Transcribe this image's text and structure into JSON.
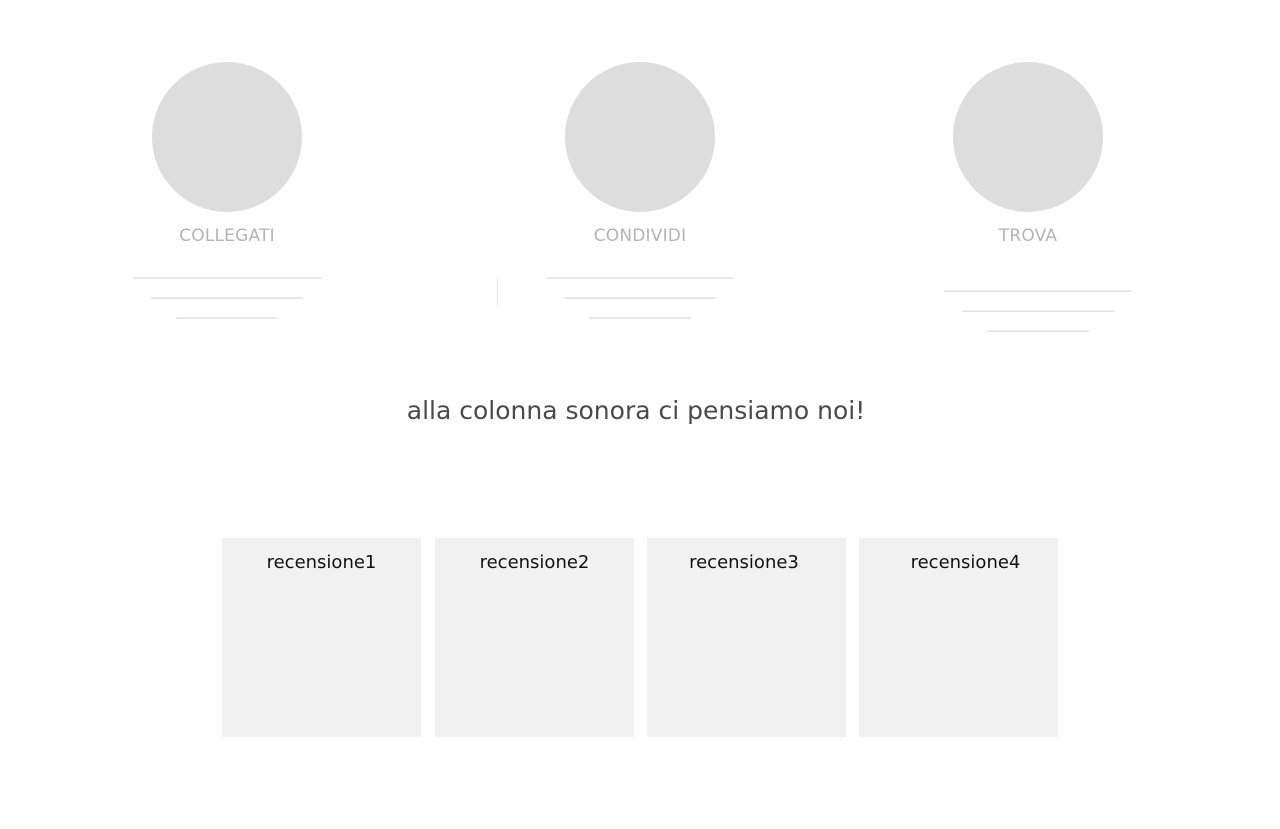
{
  "features": [
    {
      "label": "COLLEGATI",
      "lines": [
        "__________________________",
        "_____________________",
        "______________"
      ]
    },
    {
      "label": "CONDIVIDI",
      "lines": [
        "__________________________",
        "_____________________",
        "______________"
      ]
    },
    {
      "label": "TROVA",
      "lines": [
        "__________________________",
        "_____________________",
        "______________"
      ]
    }
  ],
  "tagline": "alla colonna sonora ci pensiamo noi!",
  "reviews": [
    {
      "label": "recensione1"
    },
    {
      "label": "recensione2"
    },
    {
      "label": "recensione3"
    },
    {
      "label": "recensione4"
    }
  ]
}
